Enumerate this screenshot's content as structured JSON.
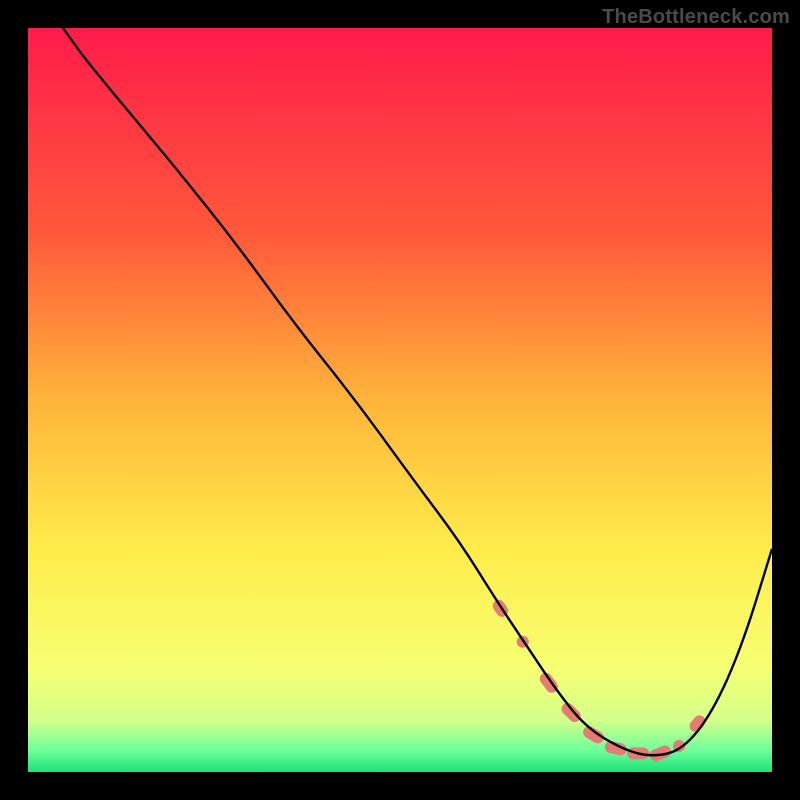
{
  "watermark": "TheBottleneck.com",
  "chart_data": {
    "type": "line",
    "title": "",
    "xlabel": "",
    "ylabel": "",
    "xlim": [
      0,
      100
    ],
    "ylim": [
      0,
      100
    ],
    "background_gradient": {
      "stops": [
        {
          "offset": 0.0,
          "color": "#ff1b4b"
        },
        {
          "offset": 0.28,
          "color": "#ff5a3a"
        },
        {
          "offset": 0.5,
          "color": "#ffb43a"
        },
        {
          "offset": 0.7,
          "color": "#ffec4a"
        },
        {
          "offset": 0.86,
          "color": "#f6ff72"
        },
        {
          "offset": 0.93,
          "color": "#d4ff8a"
        },
        {
          "offset": 0.97,
          "color": "#72ff9a"
        },
        {
          "offset": 1.0,
          "color": "#1be27a"
        }
      ]
    },
    "series": [
      {
        "name": "curve",
        "color": "#000000",
        "x": [
          2,
          6,
          10,
          15,
          20,
          28,
          36,
          44,
          52,
          58,
          63,
          67,
          71,
          75,
          80,
          84,
          88,
          92,
          96,
          100
        ],
        "y": [
          104,
          98,
          93,
          87,
          81,
          71,
          60,
          50,
          39,
          31,
          23,
          17,
          11,
          6,
          3,
          2,
          3,
          8,
          17,
          30
        ]
      }
    ],
    "markers": {
      "name": "highlight",
      "color": "#e67a75",
      "x": [
        63.5,
        66.5,
        70,
        73,
        76,
        79,
        82,
        85,
        87.5,
        90
      ],
      "y": [
        22,
        17.5,
        12,
        8,
        5,
        3.2,
        2.5,
        2.5,
        3.5,
        6.5
      ]
    }
  }
}
